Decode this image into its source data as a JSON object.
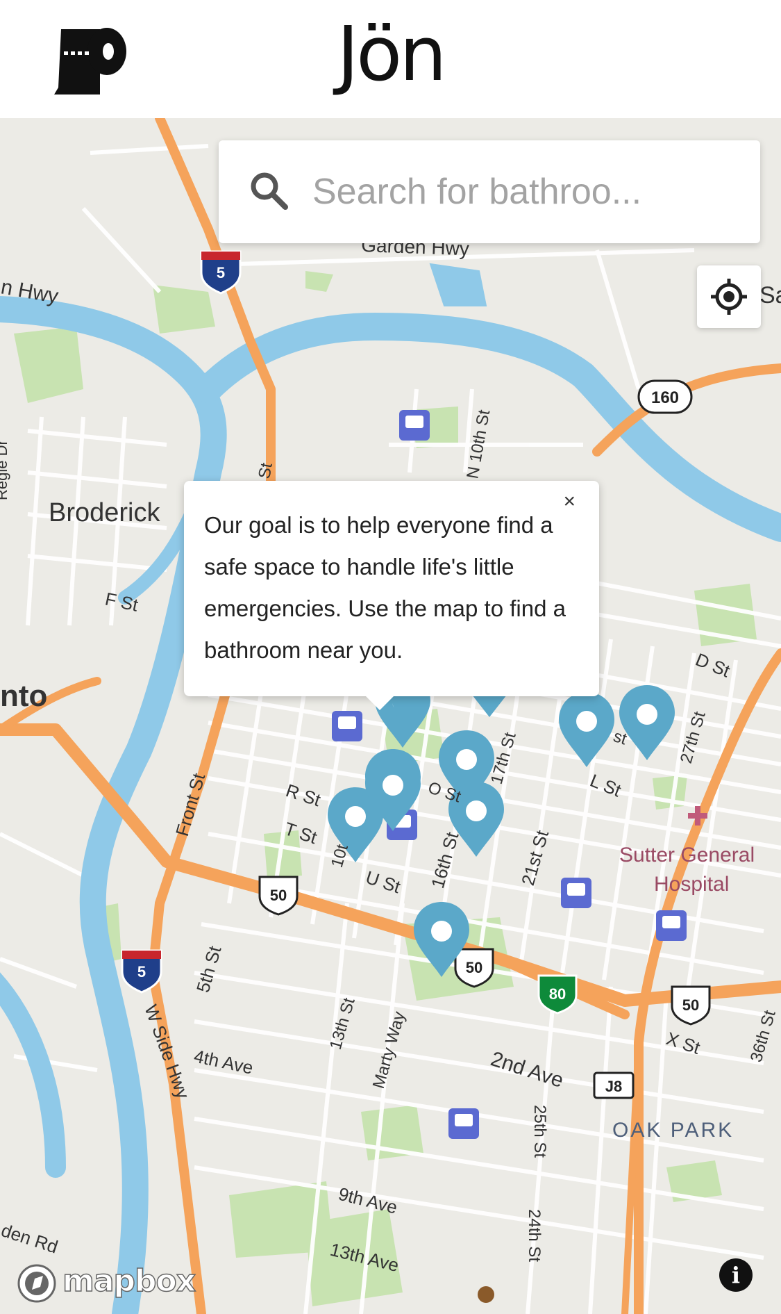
{
  "app": {
    "title": "Jön",
    "logo_icon": "toilet-paper-icon"
  },
  "search": {
    "placeholder": "Search for bathroo...",
    "icon": "search-icon"
  },
  "locate": {
    "icon": "crosshair-icon"
  },
  "popup": {
    "text": "Our goal is to help everyone find a safe space to handle life's little emergencies. Use the map to find a bathroom near you.",
    "close_label": "×"
  },
  "map": {
    "attribution": "mapbox",
    "info_label": "i",
    "labels": {
      "garden_hwy": "Garden Hwy",
      "n_hwy": "n Hwy",
      "sa": "Sa",
      "broderick": "Broderick",
      "f_st": "F St",
      "nto": "nto",
      "n10th": "N 10th St",
      "d_st": "D St",
      "l_st": "L St",
      "st27": "27th St",
      "r_st": "R St",
      "t_st": "T St",
      "u_st": "U St",
      "o_st": "O St",
      "st16": "16th St",
      "st17": "17th St",
      "st21": "21st St",
      "front_st": "Front St",
      "sutter": "Sutter General",
      "hospital": "Hospital",
      "st5": "5th St",
      "ave4": "4th Ave",
      "w_side": "W Side Hwy",
      "st13": "13th St",
      "marty": "Marty Way",
      "ave2": "2nd Ave",
      "x_st": "X St",
      "st36": "36th St",
      "st25": "25th St",
      "oak_park": "OAK PARK",
      "ave9": "9th Ave",
      "ave13": "13th Ave",
      "st24": "24th St",
      "den_rd": "den Rd",
      "regle": "Regle Dr",
      "st10a": "St",
      "st10b": "10t",
      "st21b": "st"
    },
    "shields": {
      "i5_top": "5",
      "i5_bottom": "5",
      "r160": "160",
      "us50_a": "50",
      "us50_b": "50",
      "us50_c": "50",
      "i80": "80",
      "j8": "J8"
    }
  }
}
